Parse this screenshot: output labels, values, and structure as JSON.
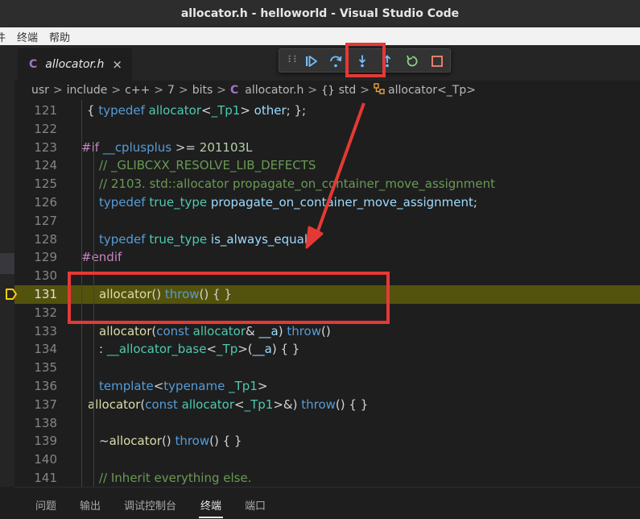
{
  "window": {
    "title": "allocator.h - helloworld - Visual Studio Code"
  },
  "menu": {
    "items": [
      "件",
      "终端",
      "帮助"
    ]
  },
  "tab": {
    "label": "allocator.h",
    "lang_icon": "C",
    "close_glyph": "×"
  },
  "breadcrumb": {
    "items": [
      "usr",
      "include",
      "c++",
      "7",
      "bits",
      "allocator.h",
      "std",
      "allocator<_Tp>"
    ],
    "file_icon": "C",
    "namespace_icon": "{}",
    "separator": ">"
  },
  "debug_toolbar": {
    "grip": "⠇⠇",
    "buttons": [
      "continue",
      "step-over",
      "step-into",
      "step-out",
      "restart",
      "stop"
    ],
    "highlighted": "step-into"
  },
  "editor": {
    "current_line": "131",
    "lines": [
      {
        "n": "121",
        "code": "{ typedef allocator<_Tp1> other; };"
      },
      {
        "n": "122",
        "code": ""
      },
      {
        "n": "123",
        "code": "#if __cplusplus >= 201103L"
      },
      {
        "n": "124",
        "code": "// _GLIBCXX_RESOLVE_LIB_DEFECTS"
      },
      {
        "n": "125",
        "code": "// 2103. std::allocator propagate_on_container_move_assignment"
      },
      {
        "n": "126",
        "code": "typedef true_type propagate_on_container_move_assignment;"
      },
      {
        "n": "127",
        "code": ""
      },
      {
        "n": "128",
        "code": "typedef true_type is_always_equal;"
      },
      {
        "n": "129",
        "code": "#endif"
      },
      {
        "n": "130",
        "code": ""
      },
      {
        "n": "131",
        "code": "allocator() throw() { }"
      },
      {
        "n": "132",
        "code": ""
      },
      {
        "n": "133",
        "code": "allocator(const allocator& __a) throw()"
      },
      {
        "n": "134",
        "code": ": __allocator_base<_Tp>(__a) { }"
      },
      {
        "n": "135",
        "code": ""
      },
      {
        "n": "136",
        "code": "template<typename _Tp1>"
      },
      {
        "n": "137",
        "code": "allocator(const allocator<_Tp1>&) throw() { }"
      },
      {
        "n": "138",
        "code": ""
      },
      {
        "n": "139",
        "code": "~allocator() throw() { }"
      },
      {
        "n": "140",
        "code": ""
      },
      {
        "n": "141",
        "code": "// Inherit everything else."
      }
    ]
  },
  "panel": {
    "tabs": [
      "问题",
      "输出",
      "调试控制台",
      "终端",
      "端口"
    ],
    "active": "终端"
  },
  "colors": {
    "accent_red": "#e53935",
    "debug_blue": "#75beff",
    "restart_green": "#89d185",
    "stop_red": "#f48771",
    "current_line": "#808000"
  }
}
